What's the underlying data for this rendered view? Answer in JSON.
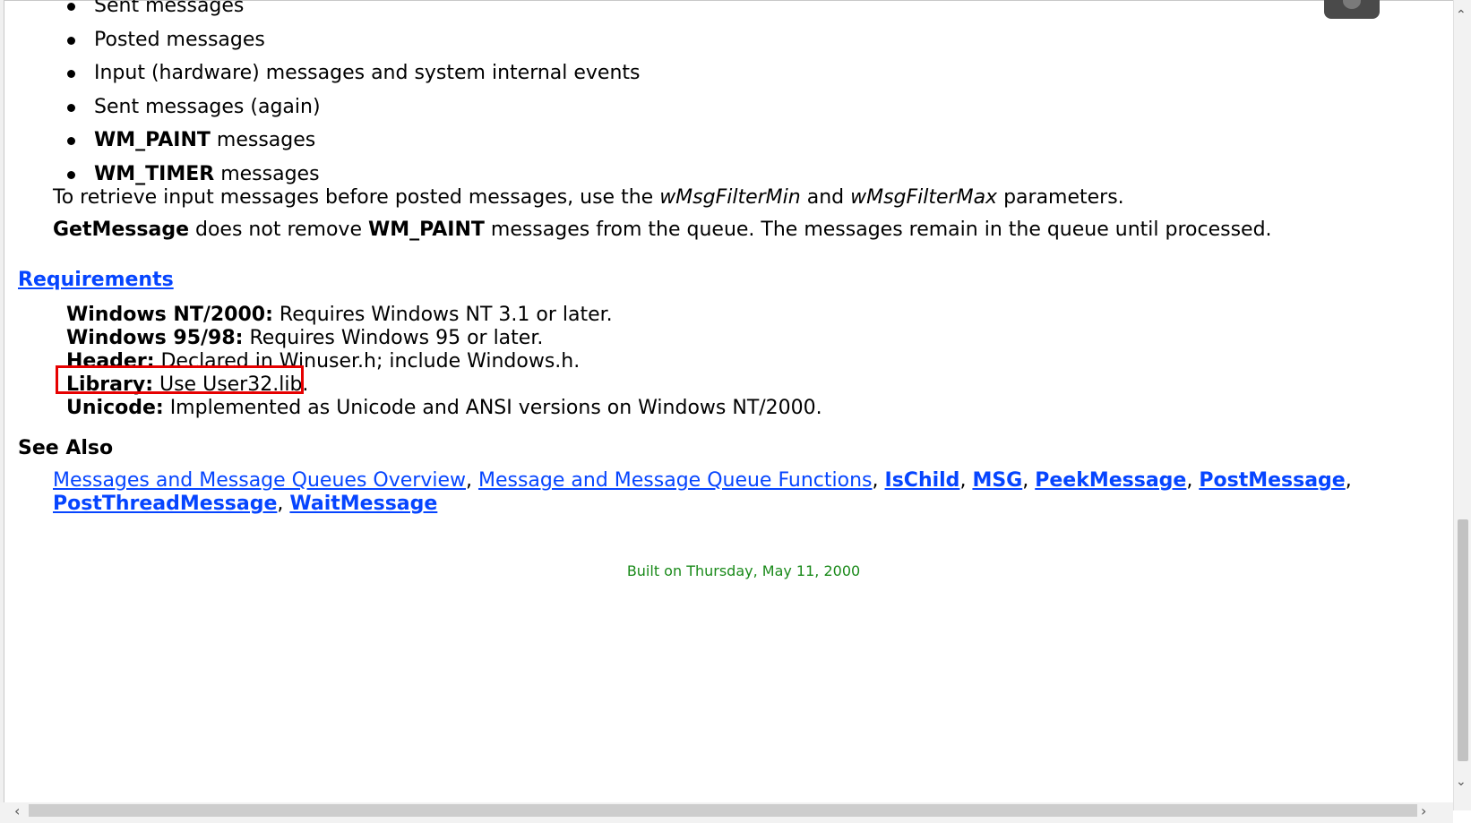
{
  "message_order_list": [
    "Sent messages",
    "Posted messages",
    "Input (hardware) messages and system internal events",
    "Sent messages (again)",
    {
      "bold": "WM_PAINT",
      "rest": " messages"
    },
    {
      "bold": "WM_TIMER",
      "rest": " messages"
    }
  ],
  "para_filter": {
    "text1": "To retrieve input messages before posted messages, use the ",
    "param1": "wMsgFilterMin",
    "text2": " and ",
    "param2": "wMsgFilterMax",
    "text3": " parameters."
  },
  "para_paint": {
    "func": "GetMessage",
    "text1": " does not remove ",
    "msg": "WM_PAINT",
    "text2": " messages from the queue. The messages remain in the queue until processed."
  },
  "requirements": {
    "heading": "Requirements",
    "lines": [
      {
        "label": "Windows NT/2000:",
        "value": " Requires Windows NT 3.1 or later."
      },
      {
        "label": "Windows 95/98:",
        "value": " Requires Windows 95 or later."
      },
      {
        "label": "Header:",
        "value": " Declared in Winuser.h; include Windows.h."
      },
      {
        "label": "Library:",
        "value": " Use User32.lib."
      },
      {
        "label": "Unicode:",
        "value": " Implemented as Unicode and ANSI versions on Windows NT/2000."
      }
    ]
  },
  "see_also": {
    "heading": "See Also",
    "links": [
      {
        "text": "Messages and Message Queues Overview",
        "bold": false
      },
      {
        "text": "Message and Message Queue Functions",
        "bold": false
      },
      {
        "text": "IsChild",
        "bold": true
      },
      {
        "text": "MSG",
        "bold": true
      },
      {
        "text": "PeekMessage",
        "bold": true
      },
      {
        "text": "PostMessage",
        "bold": true
      },
      {
        "text": "PostThreadMessage",
        "bold": true
      },
      {
        "text": "WaitMessage",
        "bold": true
      }
    ],
    "separator": ", "
  },
  "footer": {
    "built": "Built on Thursday, May 11, 2000"
  },
  "colors": {
    "link": "#0645ff",
    "footer_text": "#1a8a1a",
    "highlight_border": "#e60000"
  }
}
